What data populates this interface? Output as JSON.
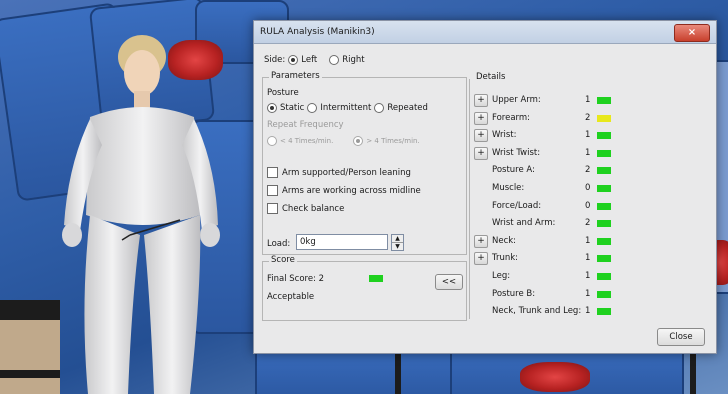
{
  "dialog": {
    "title": "RULA Analysis (Manikin3)",
    "close_glyph": "×",
    "side": {
      "label": "Side:",
      "options": [
        "Left",
        "Right"
      ],
      "selected": "Left"
    },
    "parameters": {
      "legend": "Parameters",
      "posture_label": "Posture",
      "posture_options": [
        "Static",
        "Intermittent",
        "Repeated"
      ],
      "posture_selected": "Static",
      "repeat_frequency_label": "Repeat Frequency",
      "repeat_options": [
        "< 4 Times/min.",
        "> 4 Times/min."
      ],
      "repeat_selected": "> 4 Times/min.",
      "checks": [
        "Arm supported/Person leaning",
        "Arms are working across midline",
        "Check balance"
      ],
      "load_label": "Load:",
      "load_value": "0kg"
    },
    "score": {
      "legend": "Score",
      "final_score_label": "Final Score: 2",
      "final_score_color": "#1fd11f",
      "verdict": "Acceptable",
      "collapse_label": "<<"
    },
    "details": {
      "legend": "Details",
      "expand_glyph": "+",
      "rows": [
        {
          "label": "Upper Arm:",
          "value": "1",
          "color": "#1fd11f",
          "expandable": true
        },
        {
          "label": "Forearm:",
          "value": "2",
          "color": "#e8e81c",
          "expandable": true
        },
        {
          "label": "Wrist:",
          "value": "1",
          "color": "#1fd11f",
          "expandable": true
        },
        {
          "label": "Wrist Twist:",
          "value": "1",
          "color": "#1fd11f",
          "expandable": true
        },
        {
          "label": "Posture A:",
          "value": "2",
          "color": "#1fd11f",
          "expandable": false
        },
        {
          "label": "Muscle:",
          "value": "0",
          "color": "#1fd11f",
          "expandable": false
        },
        {
          "label": "Force/Load:",
          "value": "0",
          "color": "#1fd11f",
          "expandable": false
        },
        {
          "label": "Wrist and Arm:",
          "value": "2",
          "color": "#1fd11f",
          "expandable": false
        },
        {
          "label": "Neck:",
          "value": "1",
          "color": "#1fd11f",
          "expandable": true
        },
        {
          "label": "Trunk:",
          "value": "1",
          "color": "#1fd11f",
          "expandable": true
        },
        {
          "label": "Leg:",
          "value": "1",
          "color": "#1fd11f",
          "expandable": false
        },
        {
          "label": "Posture B:",
          "value": "1",
          "color": "#1fd11f",
          "expandable": false
        },
        {
          "label": "Neck, Trunk and Leg:",
          "value": "1",
          "color": "#1fd11f",
          "expandable": false
        }
      ]
    },
    "close_button_label": "Close"
  }
}
